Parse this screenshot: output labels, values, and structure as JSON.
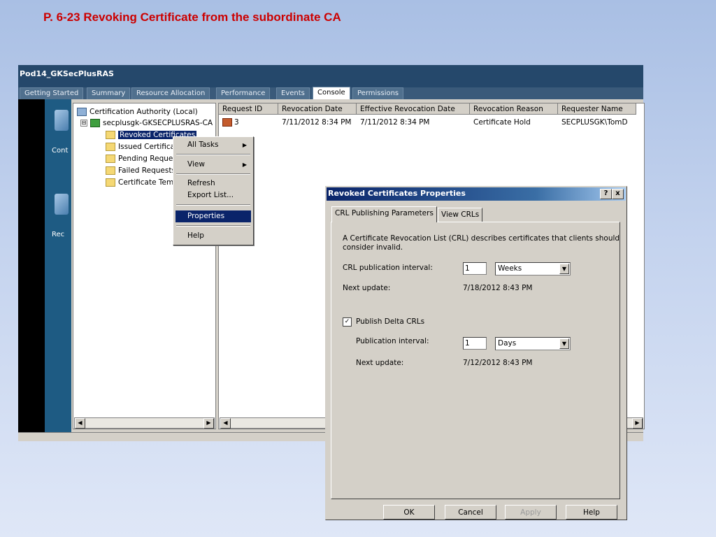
{
  "slide_title": "P. 6-23 Revoking Certificate from the subordinate CA",
  "vm": {
    "title": "Pod14_GKSecPlusRAS",
    "tabs": [
      "Getting Started",
      "Summary",
      "Resource Allocation",
      "Performance",
      "Events",
      "Console",
      "Permissions"
    ],
    "active_tab": "Console"
  },
  "desktop_labels": [
    "Cont",
    "Rec"
  ],
  "tree": {
    "root": "Certification Authority (Local)",
    "ca": "secplusgk-GKSECPLUSRAS-CA",
    "items": [
      "Revoked Certificates",
      "Issued Certificates",
      "Pending Requests",
      "Failed Requests",
      "Certificate Templates"
    ],
    "expander": "⊟"
  },
  "list": {
    "columns": [
      "Request ID",
      "Revocation Date",
      "Effective Revocation Date",
      "Revocation Reason",
      "Requester Name"
    ],
    "rows": [
      {
        "request_id": "3",
        "revocation_date": "7/11/2012 8:34 PM",
        "effective_date": "7/11/2012 8:34 PM",
        "reason": "Certificate Hold",
        "requester": "SECPLUSGK\\TomD"
      }
    ]
  },
  "context_menu": {
    "items": [
      "All Tasks",
      "View",
      "Refresh",
      "Export List...",
      "Properties",
      "Help"
    ],
    "highlighted": "Properties"
  },
  "dialog": {
    "title": "Revoked Certificates Properties",
    "help_btn": "?",
    "close_btn": "x",
    "tabs": [
      "CRL Publishing Parameters",
      "View CRLs"
    ],
    "description_line1": "A Certificate Revocation List (CRL) describes certificates that clients should",
    "description_line2": "consider invalid.",
    "crl_interval_label": "CRL publication interval:",
    "crl_interval_value": "1",
    "crl_interval_unit": "Weeks",
    "next_update_label": "Next update:",
    "next_update_value": "7/18/2012 8:43 PM",
    "publish_delta_label": "Publish Delta CRLs",
    "publish_delta_checked": "✓",
    "delta_interval_label": "Publication interval:",
    "delta_interval_value": "1",
    "delta_interval_unit": "Days",
    "delta_next_update_label": "Next update:",
    "delta_next_update_value": "7/12/2012 8:43 PM",
    "buttons": {
      "ok": "OK",
      "cancel": "Cancel",
      "apply": "Apply",
      "help": "Help"
    }
  }
}
